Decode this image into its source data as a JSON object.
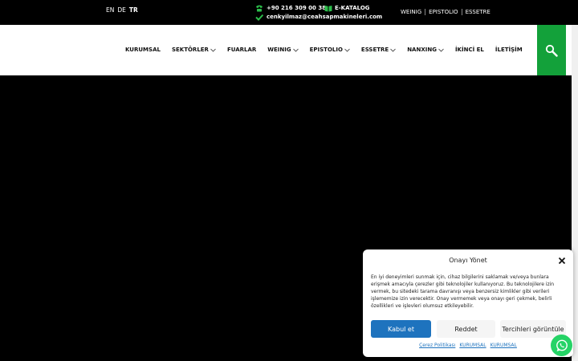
{
  "topbar": {
    "languages": [
      {
        "label": "EN",
        "active": false
      },
      {
        "label": "DE",
        "active": false
      },
      {
        "label": "TR",
        "active": true
      }
    ],
    "phone": "+90 216 309 00 38",
    "email": "cenkyilmaz@ceahsapmakineleri.com",
    "catalog": "E-KATALOG",
    "links": [
      "WEINIG",
      "EPISTOLIO",
      "ESSETRE"
    ]
  },
  "menu": {
    "items": [
      {
        "label": "KURUMSAL",
        "dropdown": false
      },
      {
        "label": "SEKTÖRLER",
        "dropdown": true
      },
      {
        "label": "FUARLAR",
        "dropdown": false
      },
      {
        "label": "WEINIG",
        "dropdown": true
      },
      {
        "label": "EPISTOLIO",
        "dropdown": true
      },
      {
        "label": "ESSETRE",
        "dropdown": true
      },
      {
        "label": "NANXING",
        "dropdown": true
      },
      {
        "label": "İKİNCİ EL",
        "dropdown": false
      },
      {
        "label": "İLETİŞİM",
        "dropdown": false
      }
    ]
  },
  "consent": {
    "title": "Onayı Yönet",
    "body": "En iyi deneyimleri sunmak için, cihaz bilgilerini saklamak ve/veya bunlara erişmek amacıyla çerezler gibi teknolojiler kullanıyoruz. Bu teknolojilere izin vermek, bu sitedeki tarama davranışı veya benzersiz kimlikler gibi verileri işlememize izin verecektir. Onay vermemek veya onayı geri çekmek, belirli özellikleri ve işlevleri olumsuz etkileyebilir.",
    "accept": "Kabul et",
    "reject": "Reddet",
    "preferences": "Tercihleri görüntüle",
    "links": [
      "Çerez Politikası",
      "KURUMSAL",
      "KURUMSAL"
    ]
  },
  "colors": {
    "accent_green": "#13a13a",
    "button_blue": "#1e73be",
    "whatsapp": "#25d366"
  },
  "icons": {
    "phone": "phone-icon",
    "catalog": "book-icon",
    "email": "check-icon",
    "search": "search-icon",
    "close": "close-icon",
    "whatsapp": "whatsapp-icon"
  }
}
